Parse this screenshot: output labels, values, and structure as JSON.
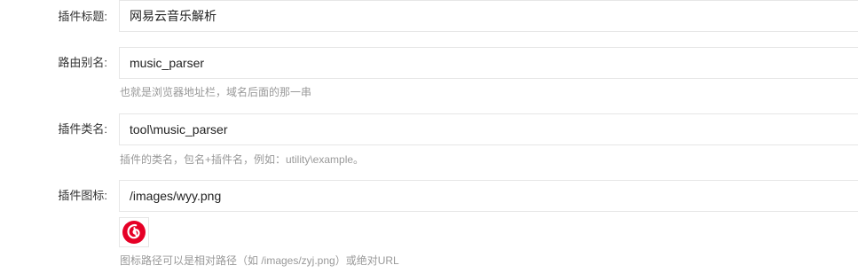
{
  "form": {
    "title_field": {
      "label": "插件标题:",
      "value": "网易云音乐解析"
    },
    "route_field": {
      "label": "路由别名:",
      "value": "music_parser",
      "help": "也就是浏览器地址栏，域名后面的那一串"
    },
    "class_field": {
      "label": "插件类名:",
      "value": "tool\\music_parser",
      "help": "插件的类名，包名+插件名，例如：utility\\example。"
    },
    "icon_field": {
      "label": "插件图标:",
      "value": "/images/wyy.png",
      "preview_icon": "netease-cloud-music-logo",
      "preview_color": "#e60026",
      "help": "图标路径可以是相对路径（如 /images/zyj.png）或绝对URL"
    }
  }
}
